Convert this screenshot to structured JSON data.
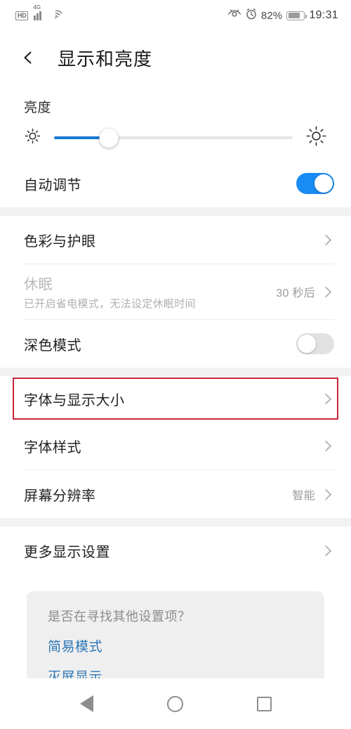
{
  "status_bar": {
    "hd_label": "HD",
    "network_label": "4G",
    "signal_icon": "signal-bars-icon",
    "wifi_icon": "wifi-icon",
    "eye_comfort_icon": "eye-comfort-icon",
    "alarm_icon": "alarm-clock-icon",
    "battery_percent": "82%",
    "battery_icon": "battery-icon",
    "time": "19:31"
  },
  "header": {
    "back_icon": "back-arrow-icon",
    "title": "显示和亮度"
  },
  "brightness": {
    "section_label": "亮度",
    "low_icon": "brightness-low-icon",
    "high_icon": "brightness-high-icon",
    "slider_percent": 23,
    "auto_label": "自动调节",
    "auto_state": "on"
  },
  "settings_group_1": [
    {
      "name": "color-and-eye-comfort",
      "label": "色彩与护眼",
      "sub": "",
      "value": "",
      "disabled": false,
      "chevron": true
    },
    {
      "name": "sleep",
      "label": "休眠",
      "sub": "已开启省电模式，无法设定休眠时间",
      "value": "30 秒后",
      "disabled": true,
      "chevron": true
    },
    {
      "name": "dark-mode",
      "label": "深色模式",
      "sub": "",
      "value": "",
      "disabled": false,
      "chevron": false,
      "toggle": "off"
    }
  ],
  "settings_group_2": [
    {
      "name": "font-and-display-size",
      "label": "字体与显示大小",
      "value": "",
      "highlighted": true,
      "chevron": true
    },
    {
      "name": "font-style",
      "label": "字体样式",
      "value": "",
      "highlighted": false,
      "chevron": true
    },
    {
      "name": "screen-resolution",
      "label": "屏幕分辨率",
      "value": "智能",
      "highlighted": false,
      "chevron": true
    }
  ],
  "settings_group_3": [
    {
      "name": "more-display-settings",
      "label": "更多显示设置",
      "value": "",
      "chevron": true
    }
  ],
  "tip_card": {
    "title": "是否在寻找其他设置项？",
    "links": [
      {
        "name": "simple-mode-link",
        "label": "简易模式"
      },
      {
        "name": "always-on-display-link",
        "label": "灭屏显示"
      }
    ]
  },
  "nav_bar": {
    "back_icon": "nav-back-triangle-icon",
    "home_icon": "nav-home-circle-icon",
    "recents_icon": "nav-recents-square-icon"
  },
  "colors": {
    "accent_blue": "#1a8cf5",
    "slider_blue": "#1777d2",
    "link_blue": "#2d77b8",
    "highlight_red": "#c9263c",
    "page_bg": "#f2f2f2"
  }
}
